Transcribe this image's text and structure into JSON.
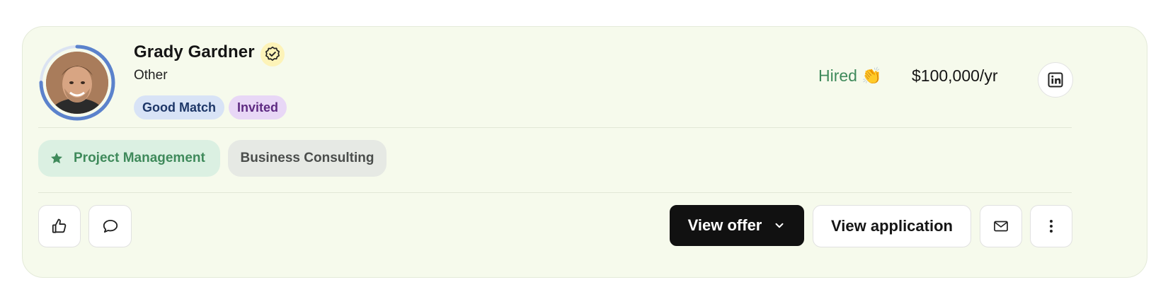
{
  "candidate": {
    "name": "Grady Gardner",
    "role": "Other",
    "tags": [
      "Good Match",
      "Invited"
    ],
    "status": "Hired 👏",
    "salary": "$100,000/yr",
    "match_progress": 0.75
  },
  "skills": {
    "primary": "Project Management",
    "secondary": "Business Consulting"
  },
  "actions": {
    "view_offer": "View offer",
    "view_application": "View application"
  },
  "icons": {
    "verified": "verified-badge-icon",
    "linkedin": "linkedin-icon",
    "star": "star-icon",
    "like": "thumbs-up-icon",
    "comment": "comment-icon",
    "dropdown": "chevron-down-icon",
    "mail": "mail-icon",
    "more": "more-vertical-icon"
  },
  "colors": {
    "card_bg": "#f6faec",
    "accent_green": "#3f8a5b",
    "ring_blue": "#5b82cc",
    "good_match_bg": "#d8e3f6",
    "invited_bg": "#e8d7f6",
    "primary_button": "#111111"
  }
}
